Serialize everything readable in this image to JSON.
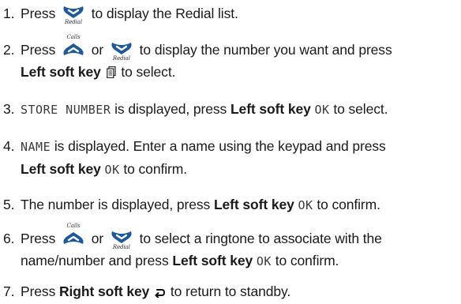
{
  "icons": {
    "down_key": {
      "name": "redial-down-key-icon",
      "caption": "Redial",
      "color": "#1e5a9a"
    },
    "up_key": {
      "name": "calls-up-key-icon",
      "caption": "Calls",
      "color": "#1e5a9a"
    },
    "menu_symbol": {
      "name": "phonebook-menu-icon"
    },
    "back_symbol": {
      "name": "back-arrow-icon"
    }
  },
  "steps": [
    {
      "number": "1.",
      "t1": "Press",
      "t2": "to display the Redial list."
    },
    {
      "number": "2.",
      "t1": "Press",
      "t2": "or",
      "t3": "to display the number you want and press",
      "b1": "Left soft key",
      "t4": "to select."
    },
    {
      "number": "3.",
      "lcd": "STORE NUMBER",
      "t1": "is displayed, press",
      "b1": "Left soft key",
      "lcd2": "OK",
      "t2": "to select."
    },
    {
      "number": "4.",
      "lcd": "NAME",
      "t1": "is displayed. Enter a name using the keypad and press",
      "b1": "Left soft key",
      "lcd2": "OK",
      "t2": "to confirm."
    },
    {
      "number": "5.",
      "t1": "The number is displayed, press",
      "b1": "Left soft key",
      "lcd2": "OK",
      "t2": "to confirm."
    },
    {
      "number": "6.",
      "t1": "Press",
      "t2": "or",
      "t3": "to select a ringtone to associate with the",
      "t4": "name/number and press",
      "b1": "Left soft key",
      "lcd2": "OK",
      "t5": "to confirm."
    },
    {
      "number": "7.",
      "t1": "Press",
      "b1": "Right soft key",
      "t2": "to return to standby."
    }
  ]
}
